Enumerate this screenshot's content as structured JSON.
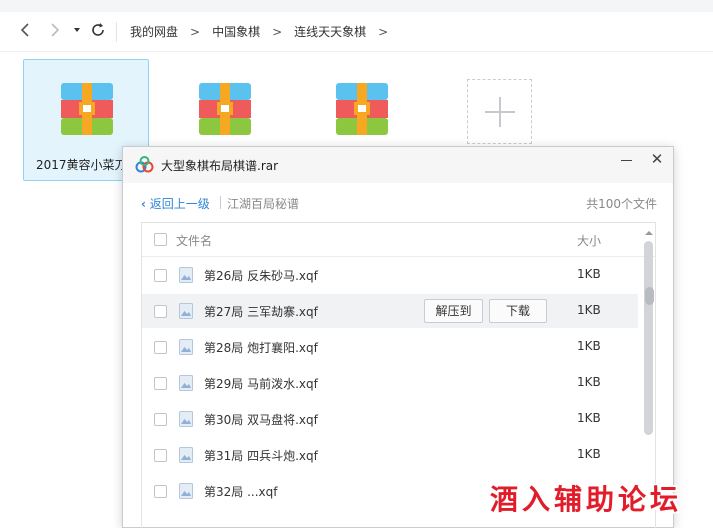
{
  "nav": {
    "back_icon": "chevron-left-icon",
    "forward_icon": "chevron-right-icon",
    "history_icon": "caret-down-icon",
    "refresh_icon": "refresh-icon",
    "breadcrumbs": [
      "我的网盘",
      "中国象棋",
      "连线天天象棋"
    ],
    "separator": ">"
  },
  "tiles": [
    {
      "name": "2017黄容小菜刀",
      "icon": "rar-archive-icon",
      "selected": true
    },
    {
      "name": "",
      "icon": "rar-archive-icon",
      "selected": false
    },
    {
      "name": "",
      "icon": "rar-archive-icon",
      "selected": false
    }
  ],
  "add_tile_icon": "plus-icon",
  "dialog": {
    "title": "大型象棋布局棋谱.rar",
    "app_icon": "baidu-cloud-icon",
    "back_label": "返回上一级",
    "current_path": "江湖百局秘谱",
    "file_count": "共100个文件",
    "header": {
      "name": "文件名",
      "size": "大小"
    },
    "hover_actions": {
      "extract": "解压到",
      "download": "下载"
    },
    "rows": [
      {
        "name": "第26局 反朱砂马.xqf",
        "size": "1KB"
      },
      {
        "name": "第27局 三军劫寨.xqf",
        "size": "1KB"
      },
      {
        "name": "第28局 炮打襄阳.xqf",
        "size": "1KB"
      },
      {
        "name": "第29局 马前泼水.xqf",
        "size": "1KB"
      },
      {
        "name": "第30局 双马盘将.xqf",
        "size": "1KB"
      },
      {
        "name": "第31局 四兵斗炮.xqf",
        "size": "1KB"
      },
      {
        "name": "第32局 ...xqf",
        "size": ""
      }
    ]
  },
  "colors": {
    "accent": "#2f86d6",
    "selection_bg": "#e3f4fd",
    "watermark": "#e11d2a"
  },
  "watermark_text": "酒入辅助论坛"
}
